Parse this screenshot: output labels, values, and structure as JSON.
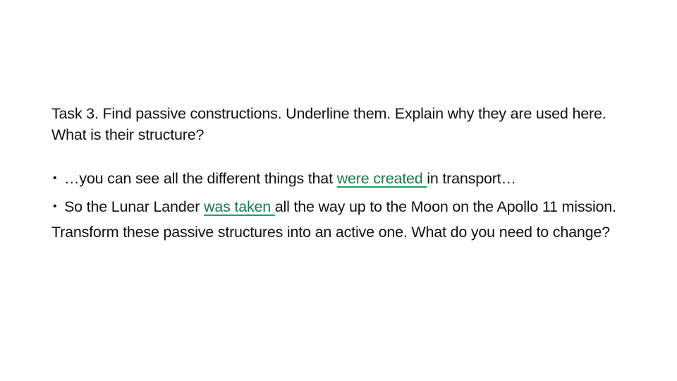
{
  "task": {
    "prompt_line": "Task 3. Find passive constructions. Underline them. Explain why they are used here. What is their structure?"
  },
  "examples": [
    {
      "before": "…you can see all the different things that ",
      "passive": "were created ",
      "after": "in  transport…"
    },
    {
      "before": "So the Lunar Lander ",
      "passive": "was  taken ",
      "after": "all the way up to the Moon on  the Apollo   11 mission."
    }
  ],
  "followup": "Transform these passive structures into an active one. What do you need to change?",
  "colors": {
    "passive_text": "#1a7a4c",
    "passive_underline": "#13a85a"
  }
}
